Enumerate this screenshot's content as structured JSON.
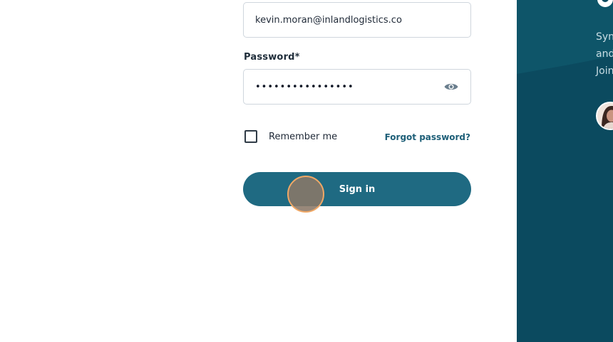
{
  "login_form": {
    "email": {
      "value": "kevin.moran@inlandlogistics.co"
    },
    "password": {
      "label": "Password*",
      "masked_value": "••••••••••••••••",
      "toggle_icon": "eye-icon"
    },
    "remember_me": {
      "label": "Remember me",
      "checked": false
    },
    "forgot_password_label": "Forgot password?",
    "sign_in_label": "Sign in"
  },
  "side_panel": {
    "lines": [
      "Syn",
      "and",
      "Join"
    ],
    "avatar_icon": "avatar-photo"
  },
  "colors": {
    "brand": "#1f6a82",
    "panel": "#0b4a5f",
    "link": "#1e5f78"
  }
}
